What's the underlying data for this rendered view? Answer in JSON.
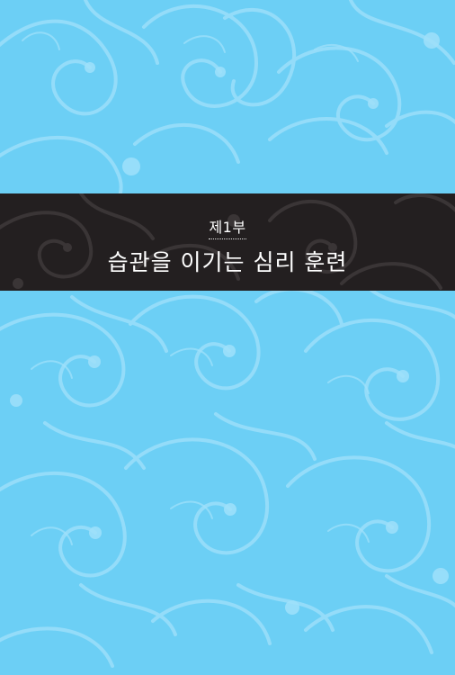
{
  "page": {
    "part_label": "제1부",
    "chapter_title": "습관을 이기는 심리 훈련"
  },
  "colors": {
    "background": "#6ccff5",
    "pattern": "#9fe0fa",
    "title_band": "#231f20",
    "band_pattern": "#3a3536",
    "text": "#ffffff"
  },
  "decoration": {
    "background_motif": "swirl-ornament-pattern"
  }
}
